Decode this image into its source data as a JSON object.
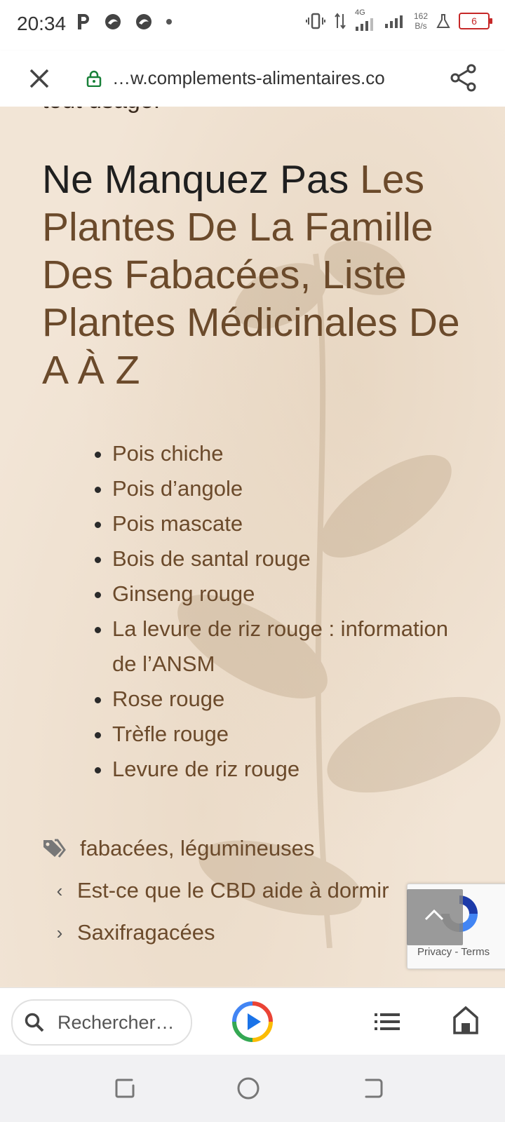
{
  "status_bar": {
    "time": "20:34",
    "network_label": "4G",
    "net_speed_value": "162",
    "net_speed_unit": "B/s",
    "battery_level": "6",
    "battery_color": "#c62828"
  },
  "url_bar": {
    "url": "…w.complements-alimentaires.co",
    "lock_color": "#188038"
  },
  "article": {
    "truncated_line": "tout usage.",
    "heading_prefix": "Ne Manquez Pas ",
    "heading_link": "Les Plantes De La Famille Des Fabacées, Liste Plantes Médicinales De A À Z",
    "list_items": [
      "Pois chiche",
      "Pois d’angole",
      "Pois mascate",
      "Bois de santal rouge",
      "Ginseng rouge",
      "La levure de riz rouge : information de l’ANSM",
      "Rose rouge",
      "Trèfle rouge",
      "Levure de riz rouge"
    ],
    "tags": "fabacées, légumineuses",
    "prev_post": "Est-ce que le CBD aide à dormir",
    "next_post": "Saxifragacées",
    "link_color": "#6b4a2b"
  },
  "recaptcha": {
    "privacy": "Privacy",
    "separator": "-",
    "terms": "Terms"
  },
  "bottom_bar": {
    "search_placeholder": "Rechercher…"
  }
}
